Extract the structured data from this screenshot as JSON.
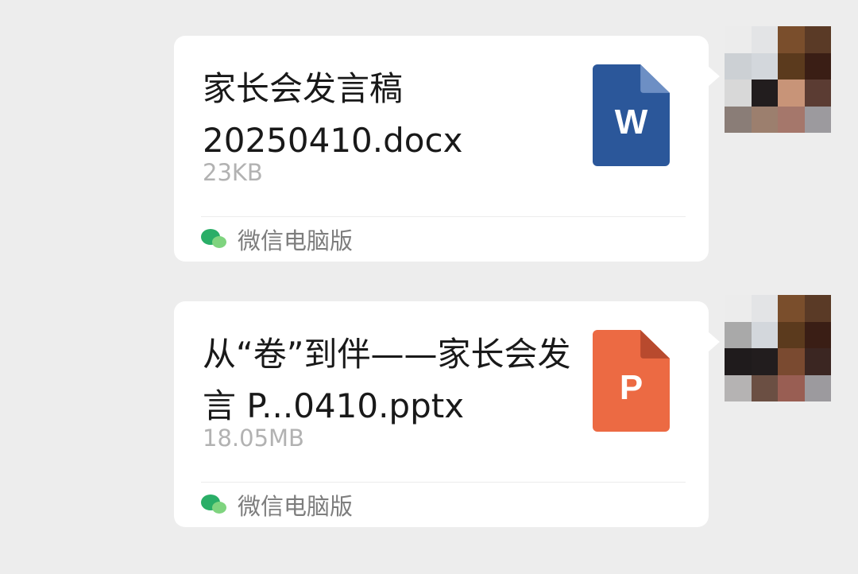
{
  "messages": [
    {
      "file_name": "家长会发言稿\n 20250410.docx",
      "file_size": "23KB",
      "file_type_letter": "W",
      "icon_color": "#2b579a",
      "icon_fold_color": "#6d8fc4",
      "source": "微信电脑版"
    },
    {
      "file_name": "从“卷”到伴——家长会发言 P...0410.pptx",
      "file_size": "18.05MB",
      "file_type_letter": "P",
      "icon_color": "#ec6a43",
      "icon_fold_color": "#b84a2e",
      "source": "微信电脑版"
    }
  ],
  "colors": {
    "background": "#ededed",
    "bubble": "#ffffff",
    "wechat_green": "#2aae67"
  }
}
